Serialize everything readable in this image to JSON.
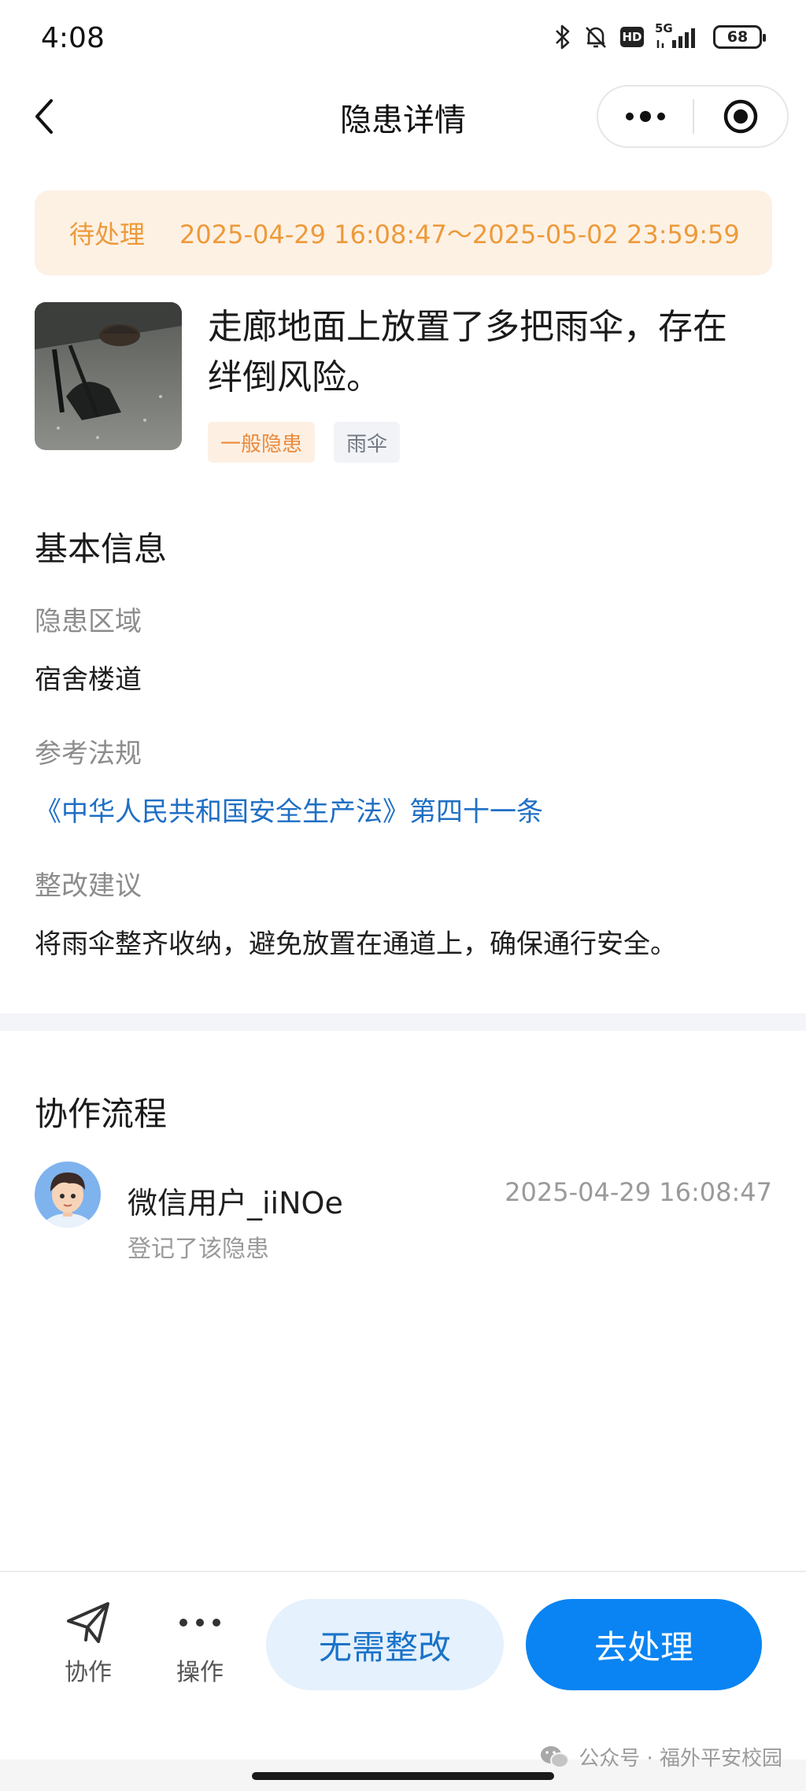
{
  "status_bar": {
    "time": "4:08",
    "hd_label": "HD",
    "network_label": "5G",
    "battery": "68"
  },
  "header": {
    "title": "隐患详情",
    "back_icon": "chevron-left-icon",
    "more_icon": "more-dots-icon",
    "close_icon": "target-close-icon"
  },
  "status_banner": {
    "status": "待处理",
    "period": "2025-04-29 16:08:47～2025-05-02 23:59:59",
    "color": "#ed9a3a",
    "background": "#fdf1e4"
  },
  "hazard": {
    "description": "走廊地面上放置了多把雨伞，存在绊倒风险。",
    "tags": [
      "一般隐患",
      "雨伞"
    ]
  },
  "basic_info": {
    "title": "基本信息",
    "fields": [
      {
        "label": "隐患区域",
        "value": "宿舍楼道"
      },
      {
        "label": "参考法规",
        "value": "《中华人民共和国安全生产法》第四十一条"
      },
      {
        "label": "整改建议",
        "value": "将雨伞整齐收纳，避免放置在通道上，确保通行安全。"
      }
    ],
    "link_color": "#1f6fc4"
  },
  "collaboration": {
    "title": "协作流程",
    "items": [
      {
        "user": "微信用户_iiNOe",
        "time": "2025-04-29 16:08:47",
        "action": "登记了该隐患"
      }
    ]
  },
  "bottom_bar": {
    "collaborate_label": "协作",
    "operate_label": "操作",
    "no_rectify_label": "无需整改",
    "process_label": "去处理",
    "primary_color": "#0a84f2"
  },
  "watermark": "公众号 · 福外平安校园"
}
